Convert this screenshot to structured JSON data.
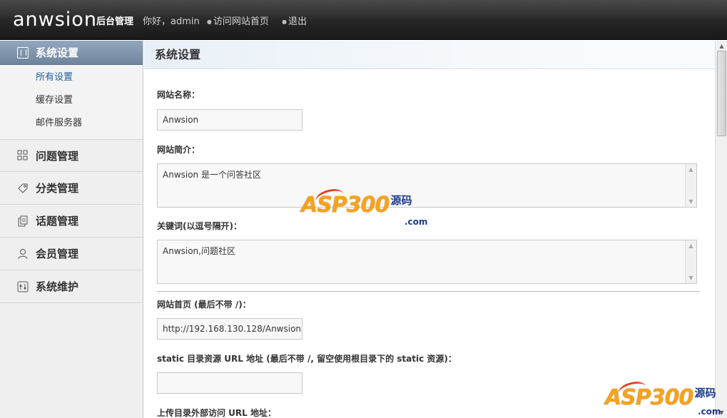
{
  "header": {
    "logo": "anwsion",
    "admin_title": "后台管理",
    "greeting": "你好，admin",
    "links": [
      "访问网站首页",
      "退出"
    ]
  },
  "sidebar": {
    "active_section": "系统设置",
    "sub_items": [
      {
        "label": "所有设置",
        "current": true
      },
      {
        "label": "缓存设置",
        "current": false
      },
      {
        "label": "邮件服务器",
        "current": false
      }
    ],
    "groups": [
      {
        "label": "问题管理",
        "icon": "grid-icon"
      },
      {
        "label": "分类管理",
        "icon": "tag-icon"
      },
      {
        "label": "话题管理",
        "icon": "documents-icon"
      },
      {
        "label": "会员管理",
        "icon": "user-icon"
      },
      {
        "label": "系统维护",
        "icon": "maintenance-icon"
      }
    ]
  },
  "main": {
    "title": "系统设置",
    "fields": {
      "site_name": {
        "label": "网站名称：",
        "value": "Anwsion"
      },
      "site_desc": {
        "label": "网站简介：",
        "value": "Anwsion 是一个问答社区"
      },
      "keywords": {
        "label": "关键词(以逗号隔开)：",
        "value": "Anwsion,问题社区"
      },
      "home_url": {
        "label": "网站首页 (最后不带 /)：",
        "value": "http://192.168.130.128/Anwsion"
      },
      "static_url": {
        "label": "static 目录资源 URL 地址 (最后不带 /, 留空使用根目录下的 static 资源)：",
        "value": ""
      },
      "upload_url": {
        "label": "上传目录外部访问 URL 地址："
      }
    }
  },
  "watermark": {
    "brand": "ASP300",
    "cn": "源码",
    "suffix": ".com"
  },
  "colors": {
    "header_bg": "#262626",
    "sidebar_active": "#7d92a9",
    "link": "#1f5d99"
  }
}
